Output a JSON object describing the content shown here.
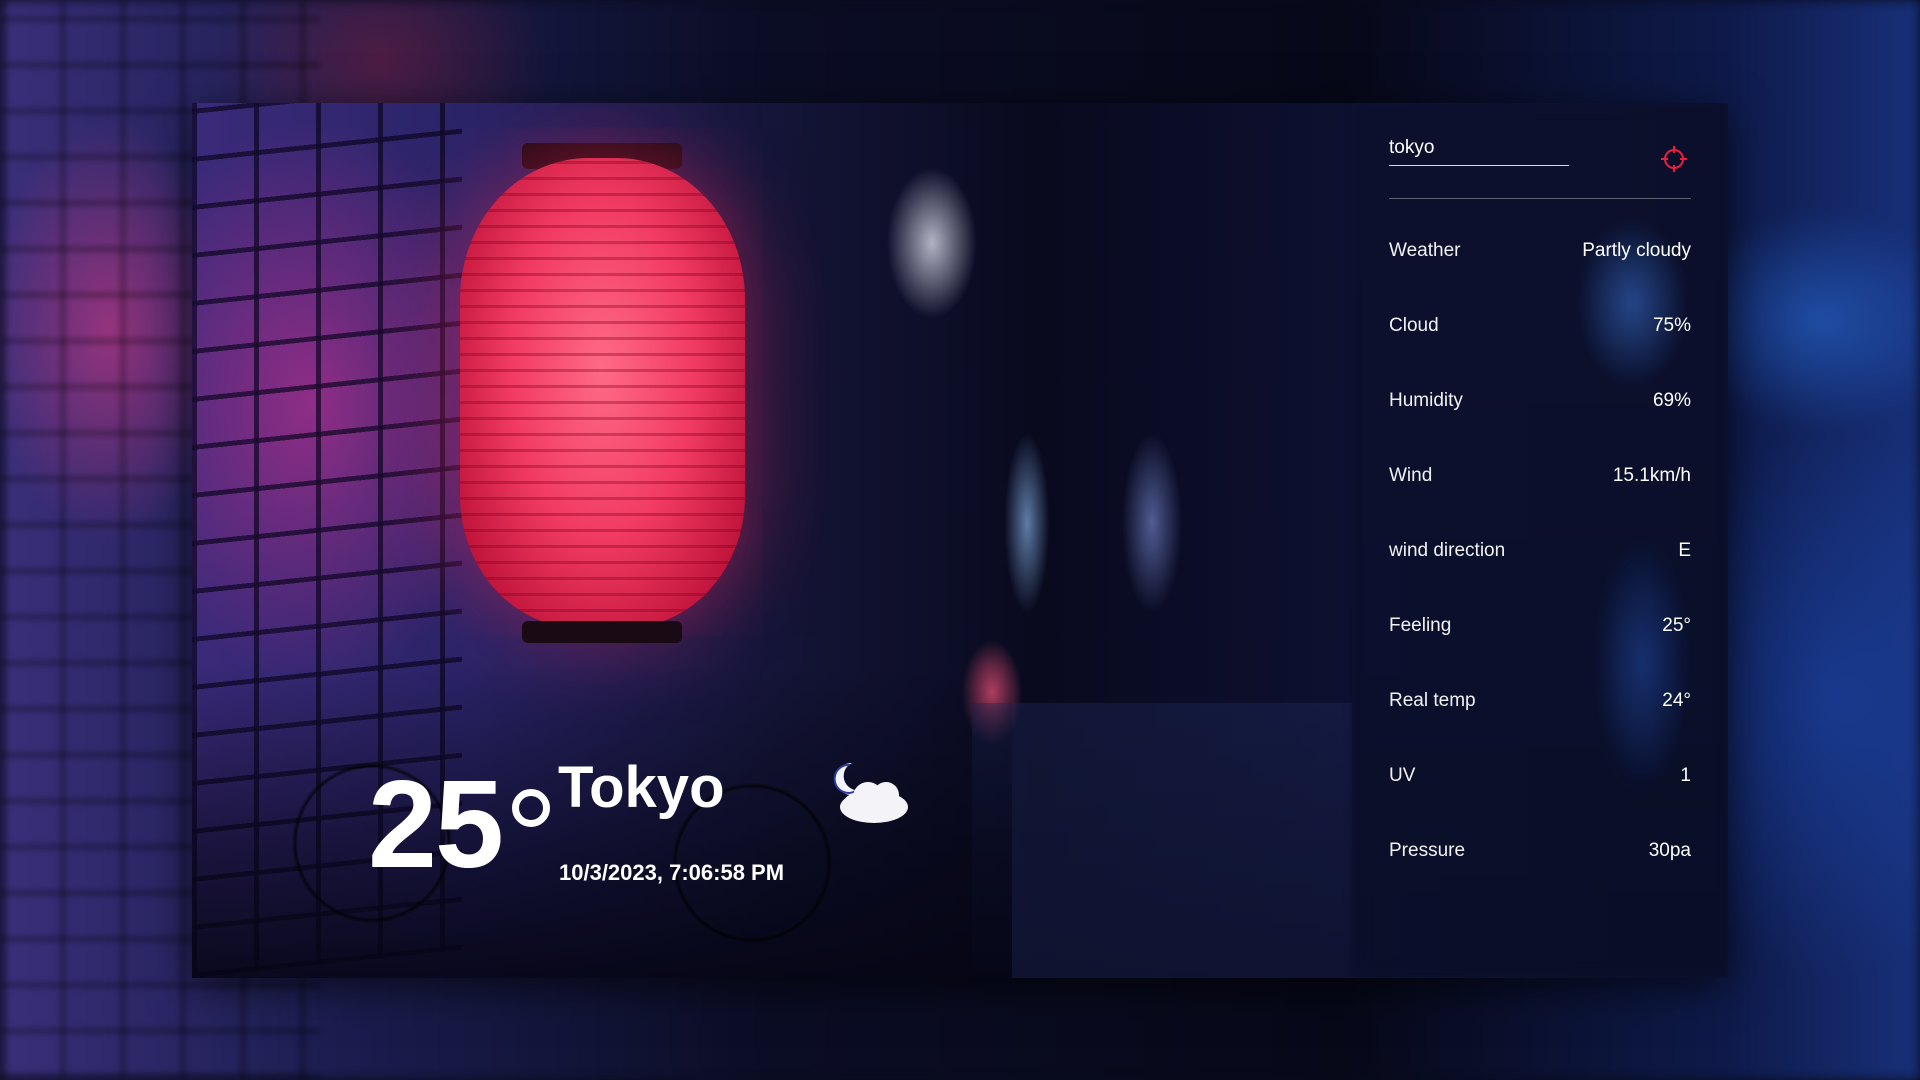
{
  "search": {
    "value": "tokyo",
    "placeholder": ""
  },
  "icons": {
    "locate": "crosshair-icon",
    "weather": "partly-cloudy-night-icon"
  },
  "colors": {
    "accent": "#e8203a"
  },
  "main": {
    "temperature": "25",
    "city": "Tokyo",
    "datetime": "10/3/2023, 7:06:58 PM"
  },
  "details": [
    {
      "label": "Weather",
      "value": "Partly cloudy"
    },
    {
      "label": "Cloud",
      "value": "75%"
    },
    {
      "label": "Humidity",
      "value": "69%"
    },
    {
      "label": "Wind",
      "value": "15.1km/h"
    },
    {
      "label": "wind direction",
      "value": "E"
    },
    {
      "label": "Feeling",
      "value": "25°"
    },
    {
      "label": "Real temp",
      "value": "24°"
    },
    {
      "label": "UV",
      "value": "1"
    },
    {
      "label": "Pressure",
      "value": "30pa"
    }
  ]
}
